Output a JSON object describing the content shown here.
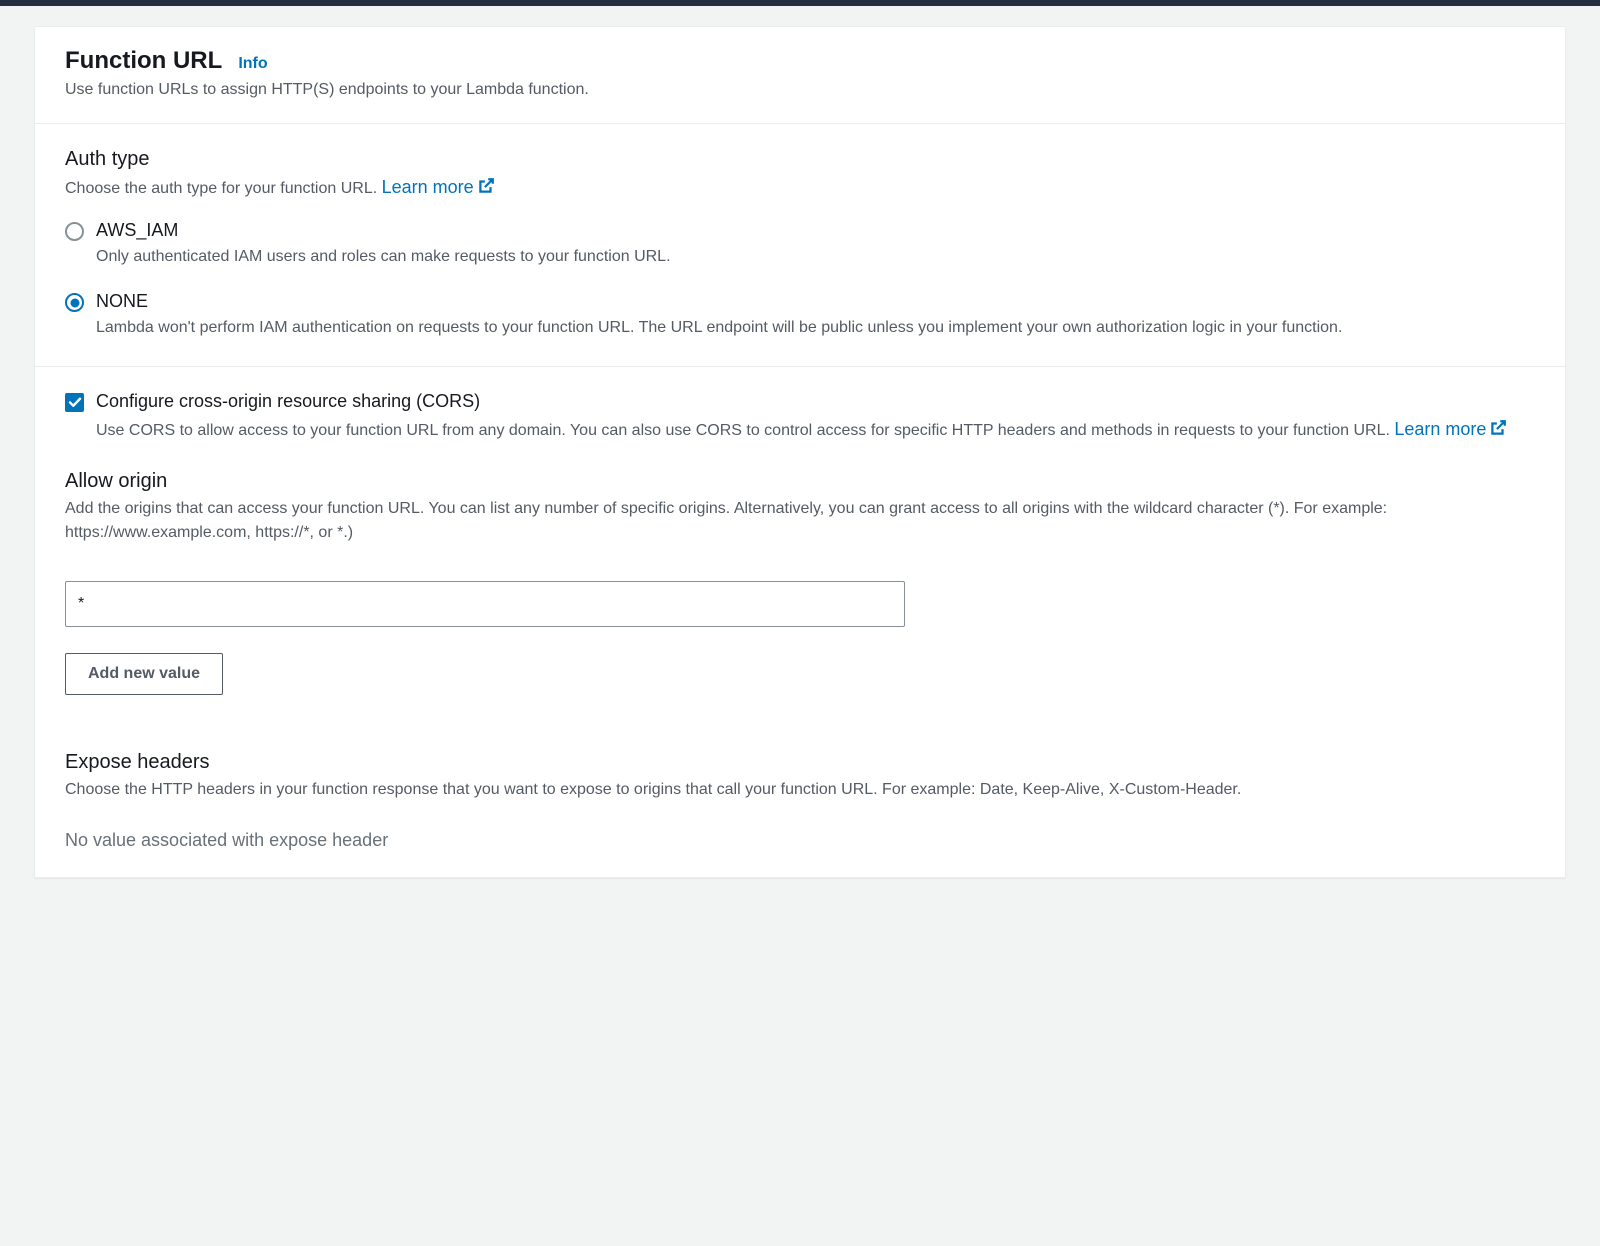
{
  "header": {
    "title": "Function URL",
    "info": "Info",
    "subtitle": "Use function URLs to assign HTTP(S) endpoints to your Lambda function."
  },
  "auth": {
    "heading": "Auth type",
    "desc_prefix": "Choose the auth type for your function URL. ",
    "learn_more": "Learn more",
    "options": [
      {
        "label": "AWS_IAM",
        "desc": "Only authenticated IAM users and roles can make requests to your function URL."
      },
      {
        "label": "NONE",
        "desc": "Lambda won't perform IAM authentication on requests to your function URL. The URL endpoint will be public unless you implement your own authorization logic in your function."
      }
    ],
    "selected": "NONE"
  },
  "cors": {
    "checkbox_label": "Configure cross-origin resource sharing (CORS)",
    "checkbox_desc": "Use CORS to allow access to your function URL from any domain. You can also use CORS to control access for specific HTTP headers and methods in requests to your function URL. ",
    "learn_more": "Learn more",
    "checked": true,
    "allow_origin": {
      "heading": "Allow origin",
      "desc": "Add the origins that can access your function URL. You can list any number of specific origins. Alternatively, you can grant access to all origins with the wildcard character (*). For example: https://www.example.com, https://*, or *.)",
      "value": "*",
      "add_button": "Add new value"
    },
    "expose_headers": {
      "heading": "Expose headers",
      "desc": "Choose the HTTP headers in your function response that you want to expose to origins that call your function URL. For example: Date, Keep-Alive, X-Custom-Header.",
      "placeholder": "No value associated with expose header"
    }
  }
}
